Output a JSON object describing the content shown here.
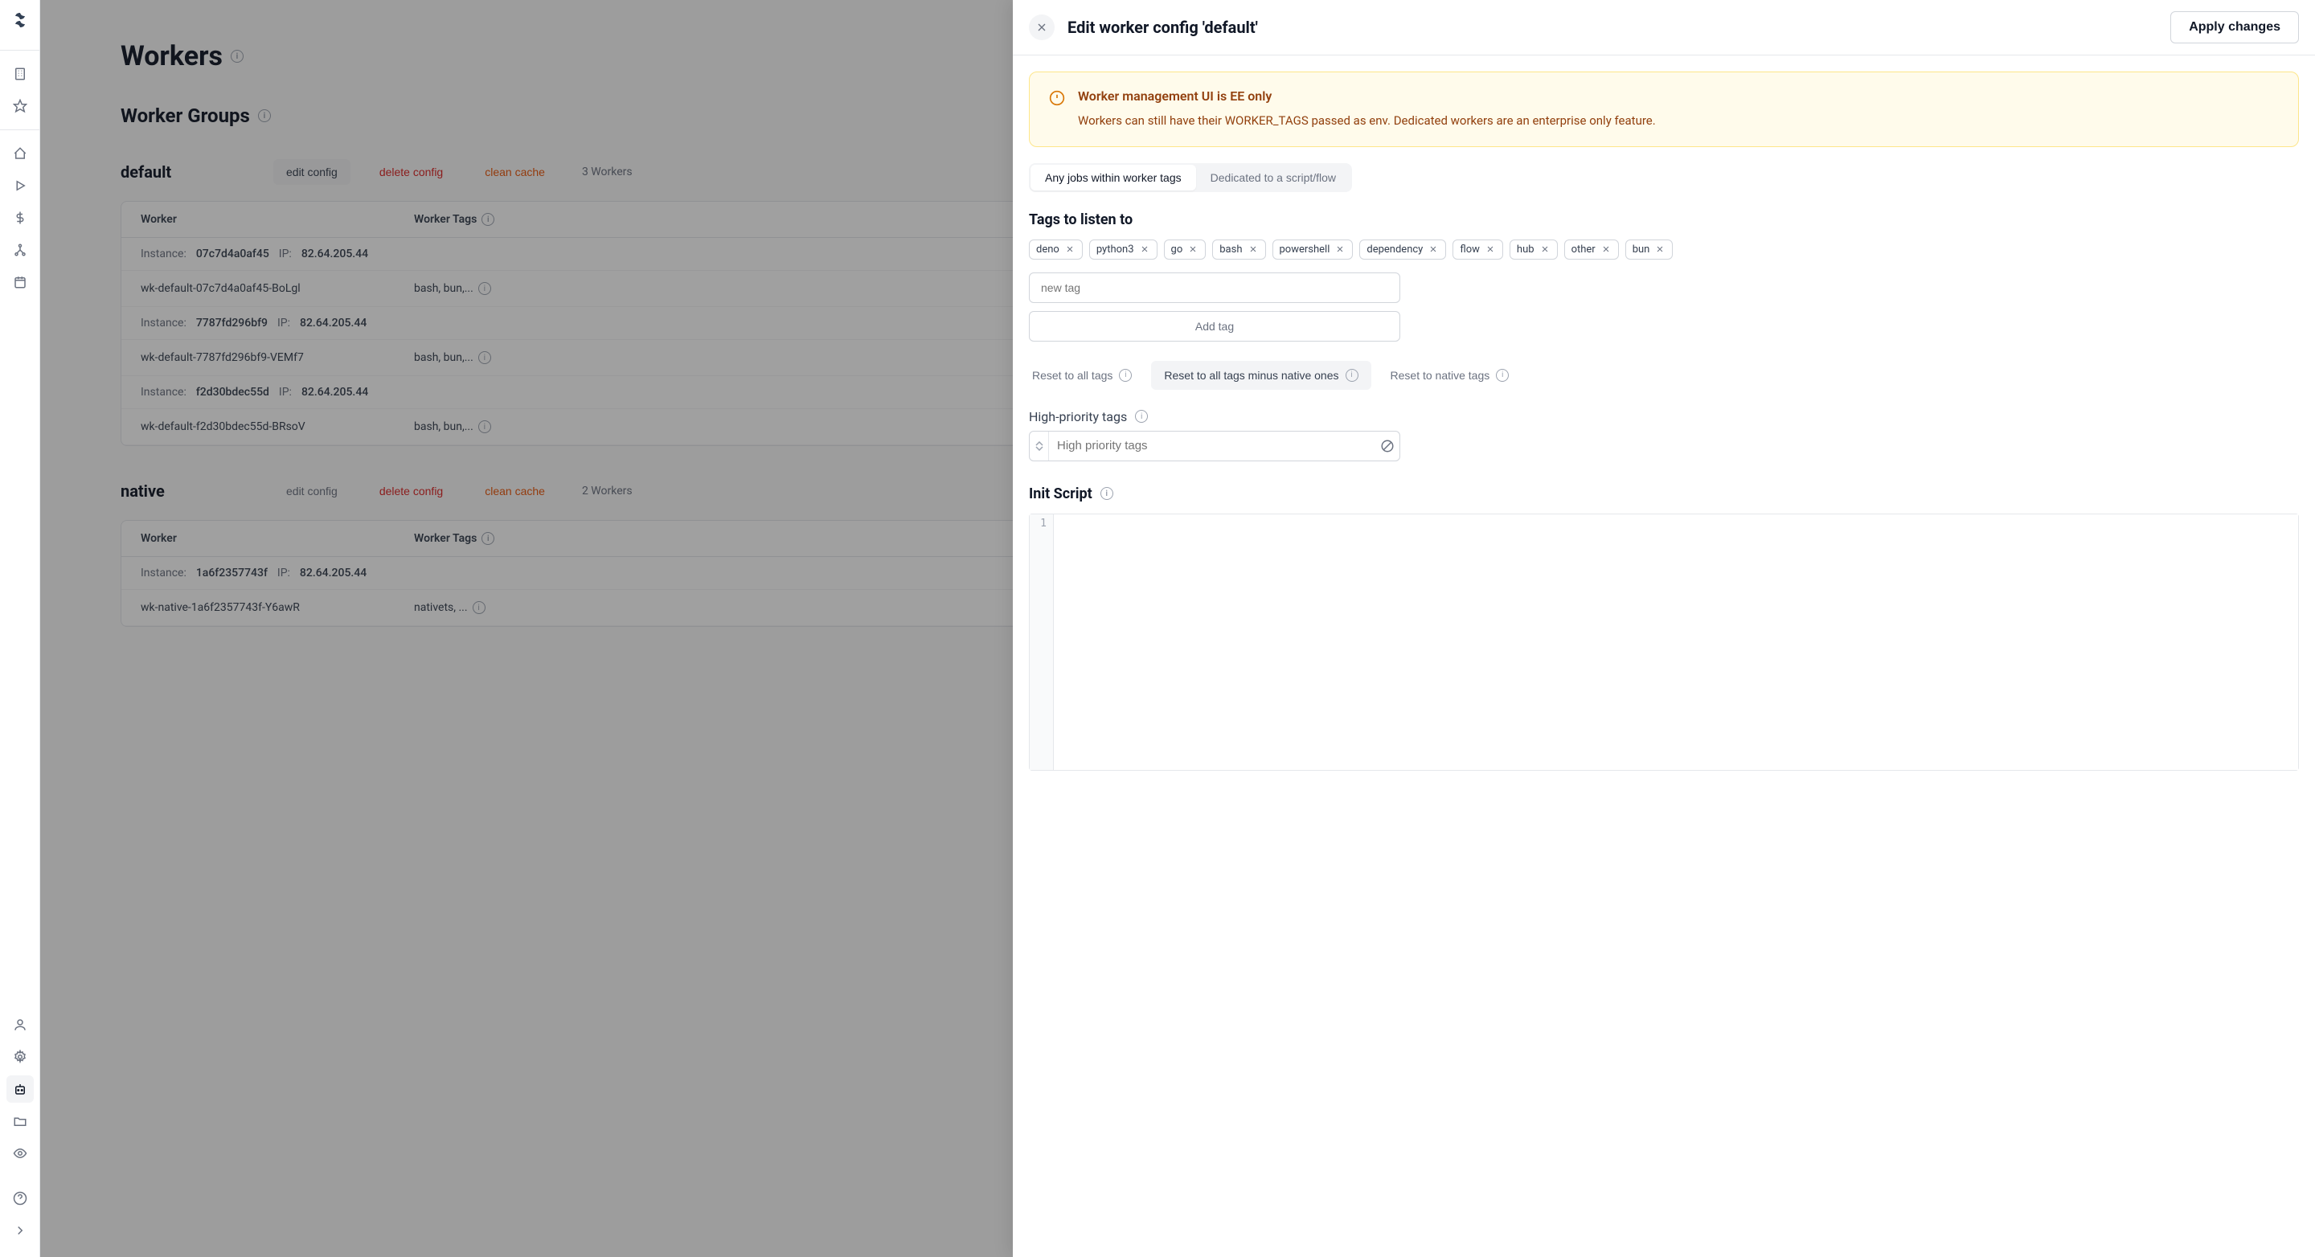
{
  "page_title": "Workers",
  "section_title": "Worker Groups",
  "groups": [
    {
      "name": "default",
      "edit_label": "edit config",
      "delete_label": "delete config",
      "clean_label": "clean cache",
      "count_label": "3 Workers",
      "col_worker": "Worker",
      "col_tags": "Worker Tags",
      "instances": [
        {
          "instance_label": "Instance:",
          "instance": "07c7d4a0af45",
          "ip_label": "IP:",
          "ip": "82.64.205.44",
          "worker": "wk-default-07c7d4a0af45-BoLgl",
          "tags": "bash, bun,..."
        },
        {
          "instance_label": "Instance:",
          "instance": "7787fd296bf9",
          "ip_label": "IP:",
          "ip": "82.64.205.44",
          "worker": "wk-default-7787fd296bf9-VEMf7",
          "tags": "bash, bun,..."
        },
        {
          "instance_label": "Instance:",
          "instance": "f2d30bdec55d",
          "ip_label": "IP:",
          "ip": "82.64.205.44",
          "worker": "wk-default-f2d30bdec55d-BRsoV",
          "tags": "bash, bun,..."
        }
      ]
    },
    {
      "name": "native",
      "edit_label": "edit config",
      "delete_label": "delete config",
      "clean_label": "clean cache",
      "count_label": "2 Workers",
      "col_worker": "Worker",
      "col_tags": "Worker Tags",
      "instances": [
        {
          "instance_label": "Instance:",
          "instance": "1a6f2357743f",
          "ip_label": "IP:",
          "ip": "82.64.205.44",
          "worker": "wk-native-1a6f2357743f-Y6awR",
          "tags": "nativets, ..."
        }
      ]
    }
  ],
  "drawer": {
    "title": "Edit worker config 'default'",
    "apply_label": "Apply changes",
    "alert_title": "Worker management UI is EE only",
    "alert_text": "Workers can still have their WORKER_TAGS passed as env. Dedicated workers are an enterprise only feature.",
    "seg_any": "Any jobs within worker tags",
    "seg_dedicated": "Dedicated to a script/flow",
    "tags_title": "Tags to listen to",
    "tags": [
      "deno",
      "python3",
      "go",
      "bash",
      "powershell",
      "dependency",
      "flow",
      "hub",
      "other",
      "bun"
    ],
    "new_tag_placeholder": "new tag",
    "add_tag_label": "Add tag",
    "reset_all": "Reset to all tags",
    "reset_minus": "Reset to all tags minus native ones",
    "reset_native": "Reset to native tags",
    "high_prio_label": "High-priority tags",
    "high_prio_placeholder": "High priority tags",
    "init_label": "Init Script",
    "gutter_line": "1"
  }
}
